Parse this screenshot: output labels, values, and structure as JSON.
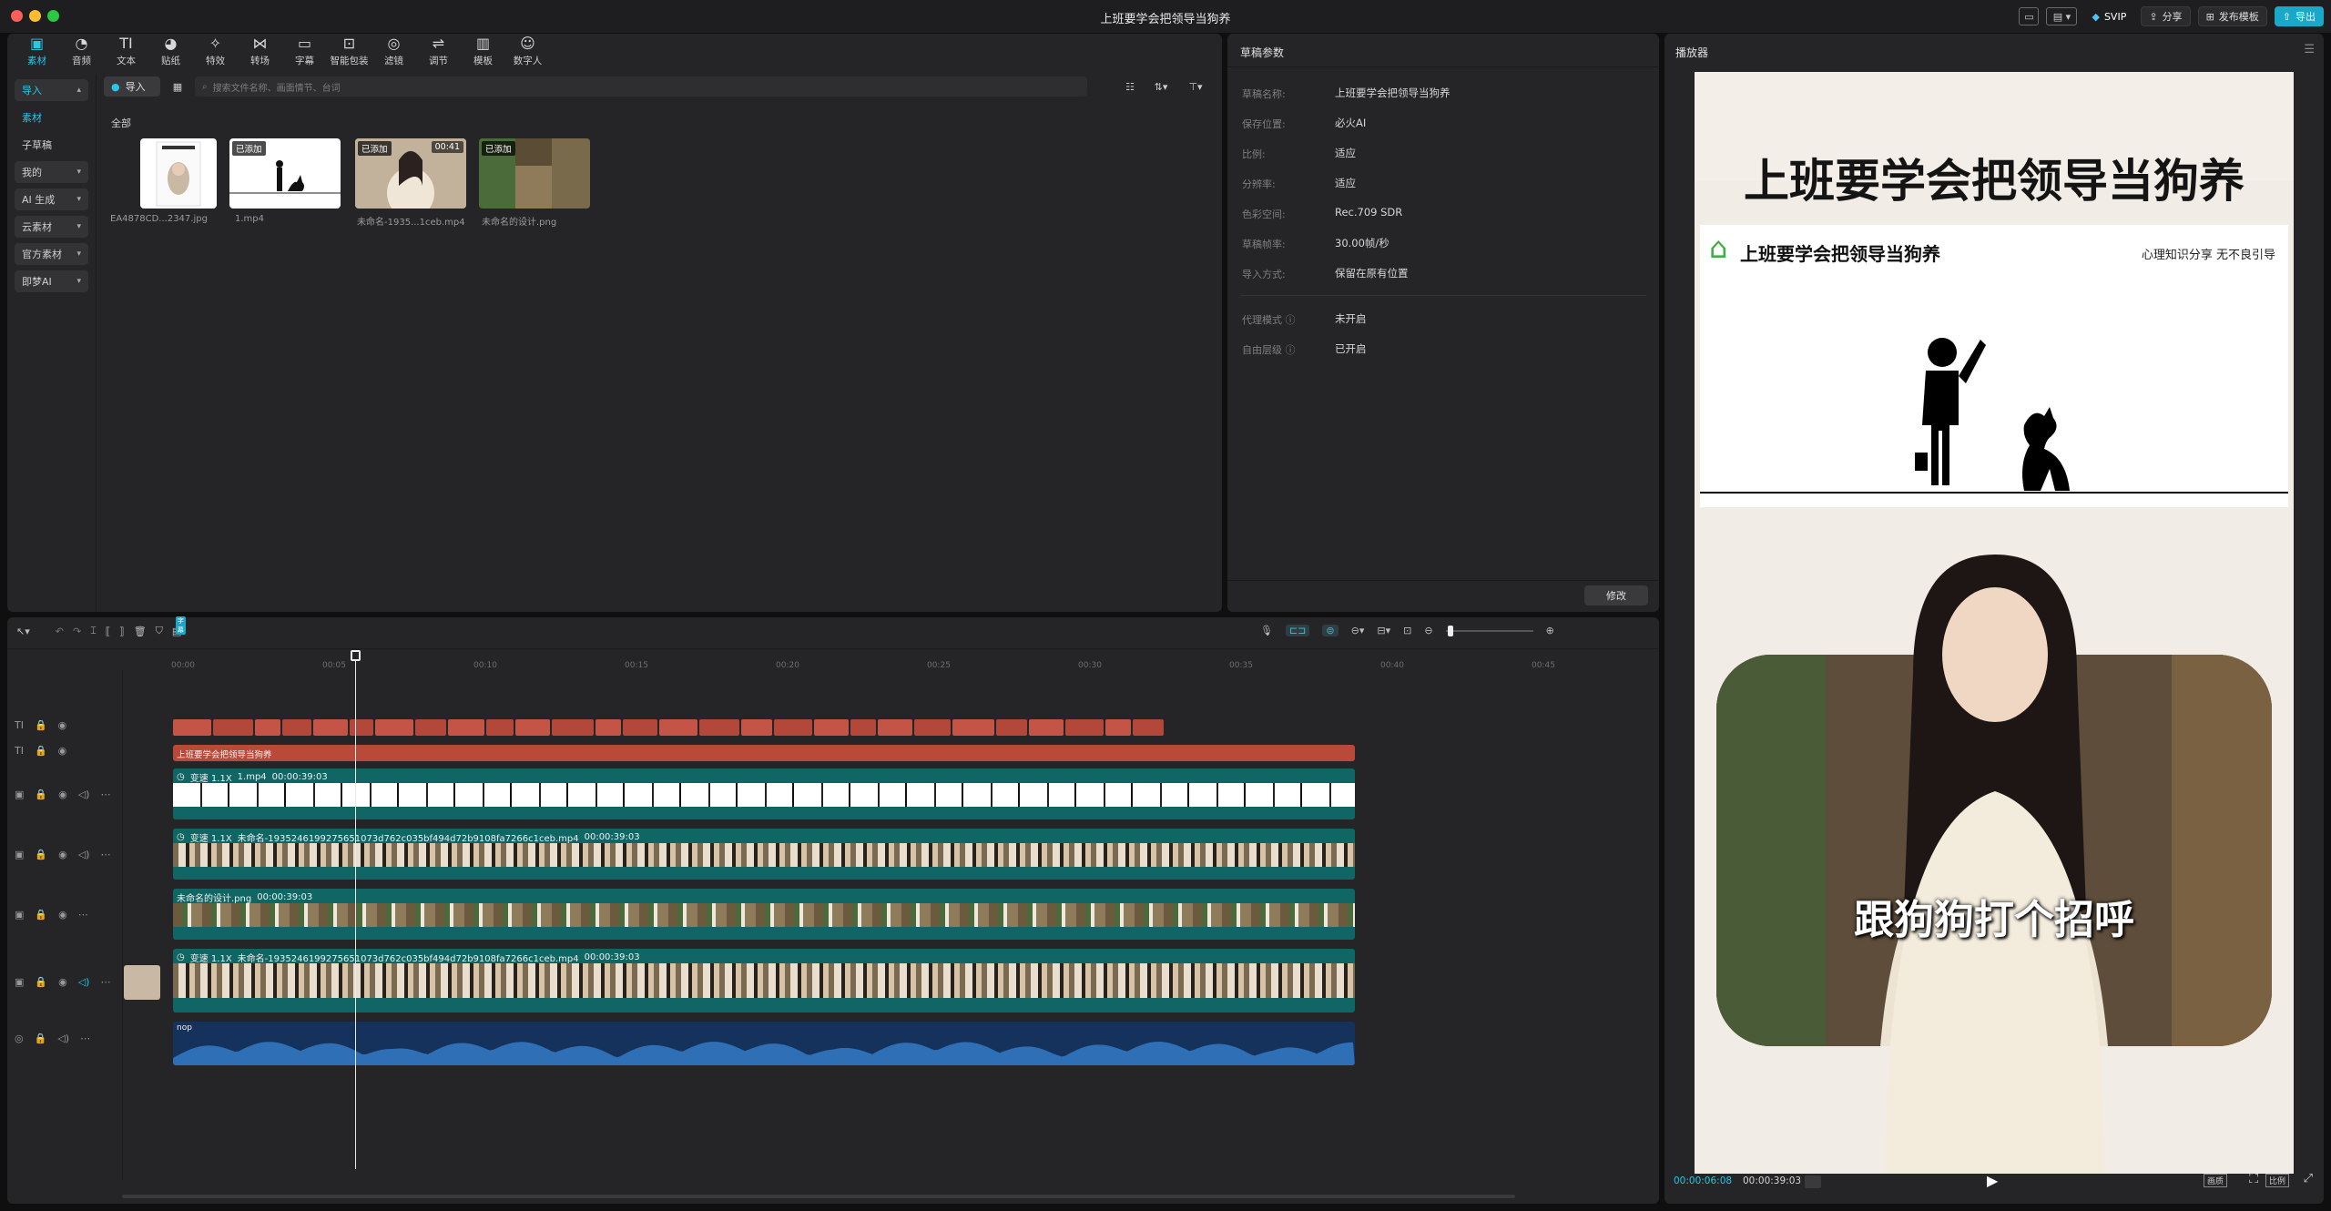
{
  "window": {
    "title": "上班要学会把领导当狗养"
  },
  "titlebar": {
    "svip": "SVIP",
    "share": "分享",
    "publish_template": "发布模板",
    "export": "导出"
  },
  "toolbar": {
    "items": [
      {
        "label": "素材",
        "icon": "media-icon"
      },
      {
        "label": "音频",
        "icon": "audio-icon"
      },
      {
        "label": "文本",
        "icon": "text-icon"
      },
      {
        "label": "贴纸",
        "icon": "sticker-icon"
      },
      {
        "label": "特效",
        "icon": "effects-icon"
      },
      {
        "label": "转场",
        "icon": "transition-icon"
      },
      {
        "label": "字幕",
        "icon": "subtitle-icon"
      },
      {
        "label": "智能包装",
        "icon": "smart-package-icon"
      },
      {
        "label": "滤镜",
        "icon": "filter-icon"
      },
      {
        "label": "调节",
        "icon": "adjust-icon"
      },
      {
        "label": "模板",
        "icon": "template-icon"
      },
      {
        "label": "数字人",
        "icon": "digital-human-icon"
      }
    ]
  },
  "sidebar": {
    "items": [
      {
        "label": "导入",
        "expandable": true
      },
      {
        "label": "素材"
      },
      {
        "label": "子草稿"
      },
      {
        "label": "我的",
        "expandable": true
      },
      {
        "label": "AI 生成",
        "expandable": true
      },
      {
        "label": "云素材",
        "expandable": true
      },
      {
        "label": "官方素材",
        "expandable": true
      },
      {
        "label": "即梦AI",
        "expandable": true
      }
    ]
  },
  "media": {
    "import_label": "导入",
    "search_placeholder": "搜索文件名称、画面情节、台词",
    "section_label": "全部",
    "items": [
      {
        "name": "EA4878CD...2347.jpg",
        "badge": "",
        "duration": ""
      },
      {
        "name": "1.mp4",
        "badge": "已添加",
        "duration": ""
      },
      {
        "name": "未命名-1935...1ceb.mp4",
        "badge": "已添加",
        "duration": "00:41"
      },
      {
        "name": "未命名的设计.png",
        "badge": "已添加",
        "duration": ""
      }
    ]
  },
  "draft": {
    "header": "草稿参数",
    "rows": [
      {
        "label": "草稿名称:",
        "value": "上班要学会把领导当狗养"
      },
      {
        "label": "保存位置:",
        "value": "必火AI"
      },
      {
        "label": "比例:",
        "value": "适应"
      },
      {
        "label": "分辨率:",
        "value": "适应"
      },
      {
        "label": "色彩空间:",
        "value": "Rec.709 SDR"
      },
      {
        "label": "草稿帧率:",
        "value": "30.00帧/秒"
      },
      {
        "label": "导入方式:",
        "value": "保留在原有位置"
      },
      {
        "label": "代理模式",
        "value": "未开启"
      },
      {
        "label": "自由层级",
        "value": "已开启"
      }
    ],
    "modify_button": "修改"
  },
  "timeline": {
    "ruler": [
      "00:00",
      "00:05",
      "00:10",
      "00:15",
      "00:20",
      "00:25",
      "00:30",
      "00:35",
      "00:40",
      "00:45"
    ],
    "playhead_fraction": 0.154,
    "text_track_label": "上班要学会把领导当狗养",
    "tracks": [
      {
        "label": "变速 1.1X",
        "name": "1.mp4",
        "time": "00:00:39:03"
      },
      {
        "label": "变速 1.1X",
        "name": "未命名-1935246199275651073d762c035bf494d72b9108fa7266c1ceb.mp4",
        "time": "00:00:39:03"
      },
      {
        "label": "",
        "name": "未命名的设计.png",
        "time": "00:00:39:03"
      },
      {
        "label": "变速 1.1X",
        "name": "未命名-1935246199275651073d762c035bf494d72b9108fa7266c1ceb.mp4",
        "time": "00:00:39:03"
      },
      {
        "label": "",
        "name": "nop",
        "time": ""
      }
    ],
    "caption_badge": "字幕"
  },
  "player": {
    "header": "播放器",
    "main_title": "上班要学会把领导当狗养",
    "card_title": "上班要学会把领导当狗养",
    "card_tagline": "心理知识分享  无不良引导",
    "subtitle": "跟狗狗打个招呼",
    "current_time": "00:00:06:08",
    "total_time": "00:00:39:03",
    "btn_ratio": "比例",
    "btn_quality": "画质"
  }
}
